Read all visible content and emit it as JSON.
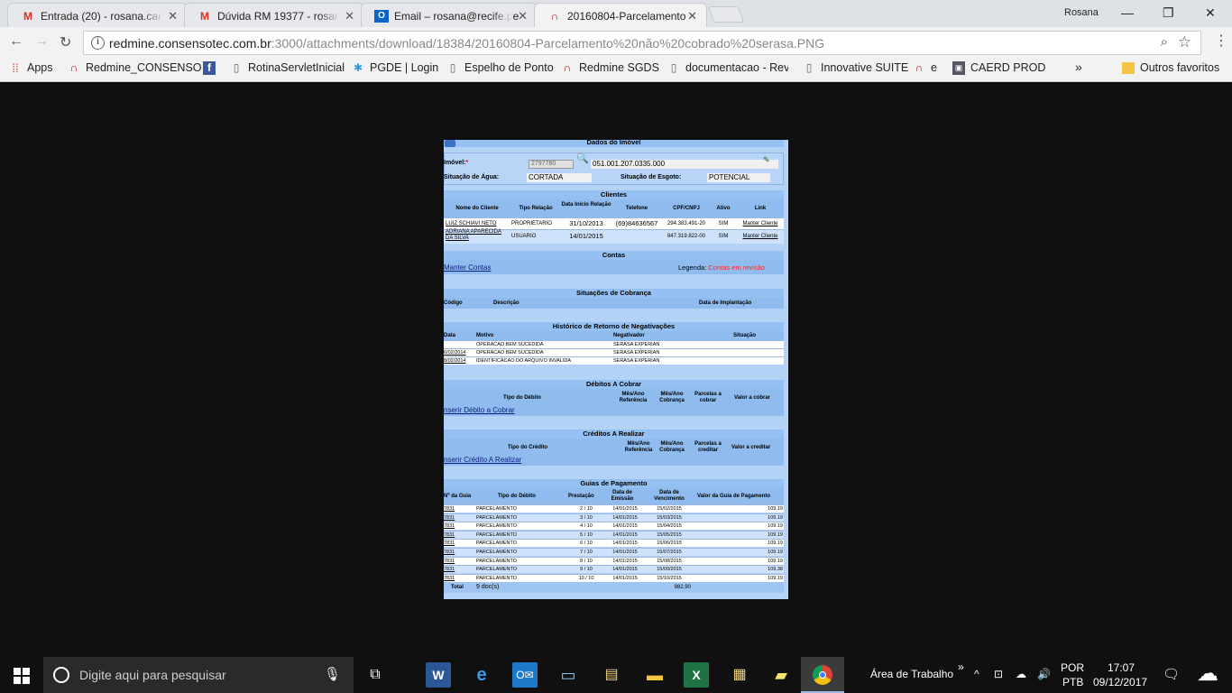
{
  "browser": {
    "tabs": [
      {
        "label": "Entrada (20) - rosana.car",
        "icon": "gmail-icon"
      },
      {
        "label": "Dúvida RM 19377 - rosar",
        "icon": "gmail-icon"
      },
      {
        "label": "Email – rosana@recife.pe",
        "icon": "outlook-icon"
      },
      {
        "label": "20160804-Parcelamento",
        "icon": "redmine-icon",
        "active": true
      }
    ],
    "user": "Rosana",
    "url_domain": "redmine.consensotec.com.br",
    "url_rest": ":3000/attachments/download/18384/20160804-Parcelamento%20não%20cobrado%20serasa.PNG",
    "bookmarks": [
      {
        "label": "Apps",
        "icon": "apps-grid-icon"
      },
      {
        "label": "Redmine_CONSENSO",
        "icon": "redmine-icon"
      },
      {
        "label": "",
        "icon": "facebook-icon"
      },
      {
        "label": "RotinaServletInicial",
        "icon": "page-icon"
      },
      {
        "label": "PGDE | Login",
        "icon": "pgde-icon"
      },
      {
        "label": "Espelho de Ponto",
        "icon": "page-icon"
      },
      {
        "label": "Redmine SGDS",
        "icon": "redmine-icon"
      },
      {
        "label": "documentacao - Revi",
        "icon": "page-icon"
      },
      {
        "label": "Innovative SUITE",
        "icon": "page-icon"
      },
      {
        "label": "e",
        "icon": "redmine-icon"
      },
      {
        "label": "CAERD PROD",
        "icon": "caerd-icon"
      }
    ],
    "more": "»",
    "other_bookmarks": "Outros favoritos"
  },
  "image": {
    "imovel_title": "Dados do Imóvel",
    "imovel_label": "Imóvel:",
    "imovel_req": "*",
    "imovel_code": "2797780",
    "imovel_inscricao": "051.001.207.0335.000",
    "agua_label": "Situação de Água:",
    "agua_value": "CORTADA",
    "esgoto_label": "Situação de Esgoto:",
    "esgoto_value": "POTENCIAL",
    "clientes_title": "Clientes",
    "clientes_cols": [
      "Nome do Cliente",
      "Tipo Relação",
      "Data Início Relação",
      "Telefone",
      "CPF/CNPJ",
      "Ativo",
      "Link"
    ],
    "clientes_rows": [
      [
        "LUIZ SCHIAVI NETO",
        "PROPRIETARIO",
        "31/10/2013",
        "(69)84636567",
        "294.383.491-20",
        "SIM",
        "Manter Cliente"
      ],
      [
        "ADRIANA APARECIDA DA SILVA",
        "USUARIO",
        "14/01/2015",
        "",
        "847.319.822-00",
        "SIM",
        "Manter Cliente"
      ]
    ],
    "contas_title": "Contas",
    "contas_link": "Manter Contas",
    "legenda_label": "Legenda:",
    "legenda_value": "Contas em revisão",
    "cobranca_title": "Situações de Cobrança",
    "cobranca_cols": [
      "Código",
      "Descrição",
      "Data de Implantação"
    ],
    "historico_title": "Histórico de Retorno de Negativações",
    "historico_cols": [
      "Data",
      "Motivo",
      "Negativador",
      "Situação"
    ],
    "historico_rows": [
      [
        "",
        "OPERACAO BEM SUCEDIDA",
        "SERASA EXPERIAN",
        ""
      ],
      [
        "6/02/2014",
        "OPERACAO BEM SUCEDIDA",
        "SERASA EXPERIAN",
        ""
      ],
      [
        "8/02/2014",
        "IDENTIFICACAO DO ARQUIVO INVALIDA",
        "SERASA EXPERIAN",
        ""
      ]
    ],
    "debitos_title": "Débitos A Cobrar",
    "debitos_cols": [
      "Tipo do Débito",
      "Mês/Ano Referência",
      "Mês/Ano Cobrança",
      "Parcelas a cobrar",
      "Valor a cobrar"
    ],
    "debitos_link": "nserir Débito a Cobrar",
    "creditos_title": "Créditos A Realizar",
    "creditos_cols": [
      "Tipo do Crédito",
      "Mês/Ano Referência",
      "Mês/Ano Cobrança",
      "Parcelas a creditar",
      "Valor a creditar"
    ],
    "creditos_link": "nserir Crédito A Realizar",
    "guias_title": "Guias de Pagamento",
    "guias_cols": [
      "Nº da Guia",
      "Tipo do Débito",
      "Prestação",
      "Data de Emissão",
      "Data de Vencimento",
      "Valor da Guia de Pagamento"
    ],
    "guias_rows": [
      [
        "7831",
        "PARCELAMENTO",
        "2 / 10",
        "14/01/2015",
        "15/02/2015",
        "109.19"
      ],
      [
        "7831",
        "PARCELAMENTO",
        "3 / 10",
        "14/01/2015",
        "15/03/2015",
        "109.19"
      ],
      [
        "7831",
        "PARCELAMENTO",
        "4 / 10",
        "14/01/2015",
        "15/04/2015",
        "109.19"
      ],
      [
        "7831",
        "PARCELAMENTO",
        "5 / 10",
        "14/01/2015",
        "15/05/2015",
        "109.19"
      ],
      [
        "7831",
        "PARCELAMENTO",
        "6 / 10",
        "14/01/2015",
        "15/06/2015",
        "109.19"
      ],
      [
        "7831",
        "PARCELAMENTO",
        "7 / 10",
        "14/01/2015",
        "15/07/2015",
        "109.19"
      ],
      [
        "7831",
        "PARCELAMENTO",
        "8 / 10",
        "14/01/2015",
        "15/08/2015",
        "109.19"
      ],
      [
        "7831",
        "PARCELAMENTO",
        "9 / 10",
        "14/01/2015",
        "15/09/2015",
        "109.38"
      ],
      [
        "7831",
        "PARCELAMENTO",
        "10 / 10",
        "14/01/2015",
        "15/10/2015",
        "109.19"
      ]
    ],
    "total_label": "Total",
    "total_docs": "9  doc(s)",
    "total_value": "982.90"
  },
  "taskbar": {
    "search_placeholder": "Digite aqui para pesquisar",
    "desktop_label": "Área de Trabalho",
    "lang1": "POR",
    "lang2": "PTB",
    "time": "17:07",
    "date": "09/12/2017"
  },
  "colors": {
    "chrome_tab_bg": "#dee1e6",
    "form_bg": "#b3d2f6",
    "header_bg": "#95c1f2",
    "legend_red": "#ff2a2a",
    "taskbar": "#101010"
  }
}
